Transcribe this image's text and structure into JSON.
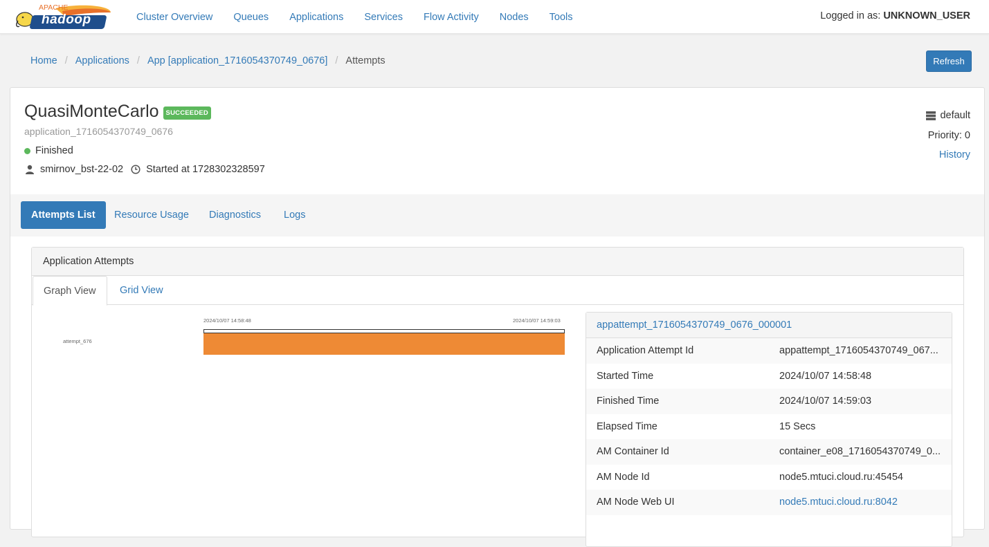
{
  "navbar": {
    "logo_top": "APACHE",
    "logo_main": "hadoop",
    "items": [
      "Cluster Overview",
      "Queues",
      "Applications",
      "Services",
      "Flow Activity",
      "Nodes",
      "Tools"
    ],
    "login_prefix": "Logged in as:",
    "login_user": "UNKNOWN_USER"
  },
  "breadcrumb": {
    "home": "Home",
    "applications": "Applications",
    "app": "App [application_1716054370749_0676]",
    "current": "Attempts"
  },
  "refresh_label": "Refresh",
  "app": {
    "name": "QuasiMonteCarlo",
    "state_badge": "SUCCEEDED",
    "id": "application_1716054370749_0676",
    "status": "Finished",
    "user": "smirnov_bst-22-02",
    "started": "Started at 1728302328597",
    "queue": "default",
    "priority": "Priority: 0",
    "history": "History"
  },
  "tabs": [
    "Attempts List",
    "Resource Usage",
    "Diagnostics",
    "Logs"
  ],
  "attempts_panel": {
    "title": "Application Attempts",
    "subtabs": [
      "Graph View",
      "Grid View"
    ]
  },
  "timeline": {
    "start_label": "2024/10/07 14:58:48",
    "end_label": "2024/10/07 14:59:03",
    "row_label": "attempt_676"
  },
  "detail": {
    "title": "appattempt_1716054370749_0676_000001",
    "rows": [
      {
        "k": "Application Attempt Id",
        "v": "appattempt_1716054370749_067..."
      },
      {
        "k": "Started Time",
        "v": "2024/10/07 14:58:48"
      },
      {
        "k": "Finished Time",
        "v": "2024/10/07 14:59:03"
      },
      {
        "k": "Elapsed Time",
        "v": "15 Secs"
      },
      {
        "k": "AM Container Id",
        "v": "container_e08_1716054370749_0..."
      },
      {
        "k": "AM Node Id",
        "v": "node5.mtuci.cloud.ru:45454"
      },
      {
        "k": "AM Node Web UI",
        "v": "node5.mtuci.cloud.ru:8042"
      }
    ]
  },
  "colors": {
    "primary": "#337ab7",
    "success": "#5cb85c",
    "bar": "#ee8a35"
  }
}
